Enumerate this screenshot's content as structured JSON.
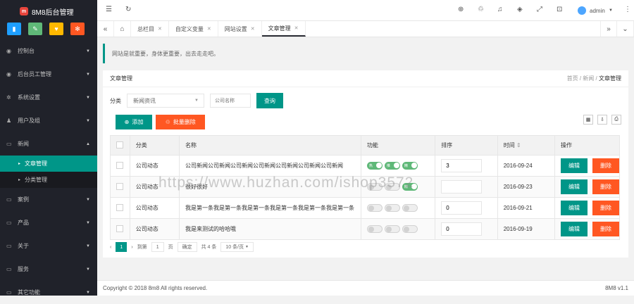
{
  "app": {
    "title": "8M8后台管理",
    "logo_letter": "m"
  },
  "colors": {
    "accent": "#009688",
    "danger": "#ff5722",
    "sidebar": "#20222a"
  },
  "quick": [
    {
      "icon": "chart-icon",
      "glyph": "▮",
      "color": "#1e9fff"
    },
    {
      "icon": "pencil-icon",
      "glyph": "✎",
      "color": "#5fb878"
    },
    {
      "icon": "shirt-icon",
      "glyph": "♥",
      "color": "#ffb800"
    },
    {
      "icon": "gear-icon",
      "glyph": "✻",
      "color": "#ff5722"
    }
  ],
  "sidebar": {
    "items": [
      {
        "label": "控制台",
        "icon": "dashboard-icon",
        "arrow": "▼"
      },
      {
        "label": "后台员工管理",
        "icon": "dashboard-icon",
        "arrow": "▼"
      },
      {
        "label": "系统设置",
        "icon": "gear-icon",
        "arrow": "▼"
      },
      {
        "label": "用户及组",
        "icon": "users-icon",
        "arrow": "▼"
      },
      {
        "label": "新闻",
        "icon": "monitor-icon",
        "arrow": "▲"
      }
    ],
    "sub": [
      {
        "label": "文章管理",
        "active": true
      },
      {
        "label": "分类管理",
        "active": false
      }
    ],
    "items2": [
      {
        "label": "案例",
        "icon": "monitor-icon",
        "arrow": "▼"
      },
      {
        "label": "产品",
        "icon": "monitor-icon",
        "arrow": "▼"
      },
      {
        "label": "关于",
        "icon": "monitor-icon",
        "arrow": "▼"
      },
      {
        "label": "服务",
        "icon": "monitor-icon",
        "arrow": "▼"
      },
      {
        "label": "其它功能",
        "icon": "monitor-icon",
        "arrow": "▼"
      }
    ]
  },
  "topbar": {
    "user": "admin",
    "user_arrow": "▼"
  },
  "tabs": [
    {
      "label": "总栏目"
    },
    {
      "label": "自定义变量"
    },
    {
      "label": "网站设置"
    },
    {
      "label": "文章管理",
      "active": true
    }
  ],
  "notice": "网站是就重要，身体更重要，出去走走吧。",
  "card": {
    "title": "文章管理",
    "crumbs": [
      "首页",
      "新闻",
      "文章管理"
    ],
    "sep": "/"
  },
  "filter": {
    "label": "分类",
    "select_value": "新闻资讯",
    "keyword_placeholder": "公司名称",
    "search_label": "查询"
  },
  "toolbar": {
    "add_label": "添加",
    "batch_delete_label": "批量删除"
  },
  "table": {
    "headers": [
      "分类",
      "名称",
      "功能",
      "排序",
      "时间",
      "操作"
    ],
    "sort_glyph": "⇕",
    "switch_labels": [
      "热",
      "推",
      "精"
    ],
    "edit_label": "编辑",
    "delete_label": "删除",
    "rows": [
      {
        "category": "公司动态",
        "name": "公司新闻公司新闻公司新闻公司新闻公司新闻公司新闻公司新闻",
        "switches": [
          true,
          true,
          true
        ],
        "order": "3",
        "time": "2016-09-24"
      },
      {
        "category": "公司动态",
        "name": "很好很好",
        "switches": [
          false,
          false,
          true
        ],
        "order": "",
        "time": "2016-09-23"
      },
      {
        "category": "公司动态",
        "name": "我是第一条我是第一条我是第一条我是第一条我是第一条我是第一条",
        "switches": [
          false,
          false,
          false
        ],
        "order": "0",
        "time": "2016-09-21"
      },
      {
        "category": "公司动态",
        "name": "我是来测试的哈哈哦",
        "switches": [
          false,
          false,
          false
        ],
        "order": "0",
        "time": "2016-09-19"
      }
    ]
  },
  "pager": {
    "prev": "‹",
    "current": "1",
    "next": "›",
    "goto_label": "到第",
    "goto_value": "1",
    "page_unit": "页",
    "confirm": "确定",
    "total": "共 4 条",
    "per_page": "10 条/页"
  },
  "footer": {
    "copyright": "Copyright © 2018 8m8 All rights reserved.",
    "version": "8M8 v1.1"
  },
  "watermark": "https://www.huzhan.com/ishop3572"
}
